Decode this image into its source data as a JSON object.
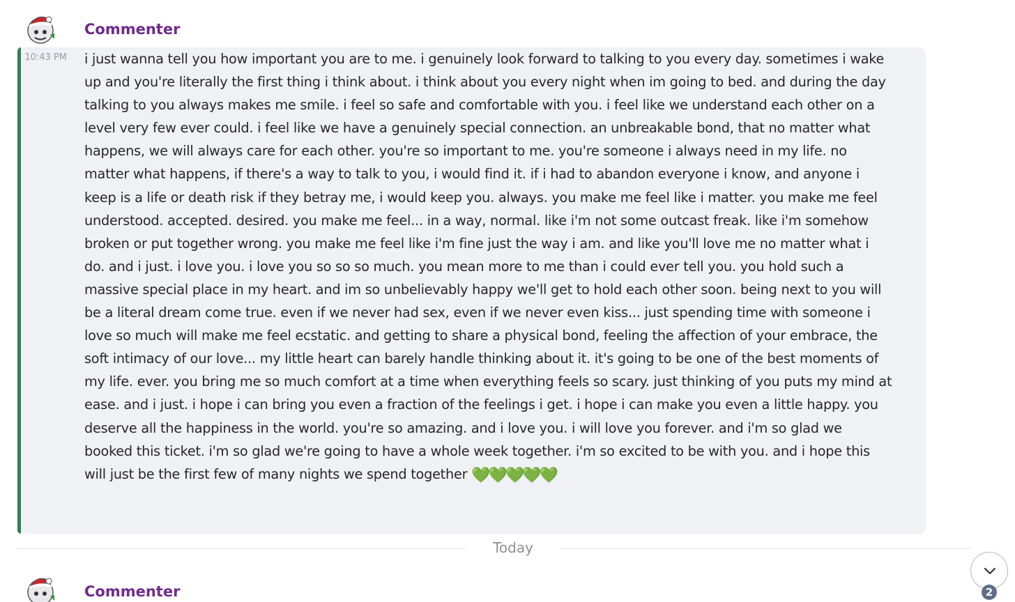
{
  "messages": [
    {
      "author": "Commenter",
      "avatar_icon": "santa-hat-avatar-icon",
      "timestamp": "10:43 PM",
      "text": "i just wanna tell you how important you are to me. i genuinely look forward to talking to you every day. sometimes i wake up and you're literally the first thing i think about. i think about you every night when im going to bed. and during the day talking to you always makes me smile. i feel so safe and comfortable with you. i feel like we understand each other on a level very few ever could. i feel like we have a genuinely special connection. an unbreakable bond, that no matter what happens, we will always care for each other. you're so important to me. you're someone i always need in my life. no matter what happens, if there's a way to talk to you, i would find it. if i had to abandon everyone i know, and anyone i keep is a life or death risk if they betray me, i would keep you. always. you make me feel like i matter. you make me feel understood. accepted. desired. you make me feel... in a way, normal. like i'm not some outcast freak. like i'm somehow broken or put together wrong. you make me feel like i'm fine just the way i am. and like you'll love me no matter what i do. and i just. i love you. i love you so  so so much. you mean more to me than i could ever tell you. you hold such a massive special place in my heart. and im so unbelievably happy we'll get to hold each other soon. being next to you will be a literal dream come true. even if we never had sex, even if we never even kiss... just spending time with someone i love so much will make me feel ecstatic. and getting to share a physical bond, feeling the affection of your embrace, the soft intimacy of our love... my little heart can barely handle thinking about it. it's going to be one of the best moments of my life. ever. you bring me so much comfort at a time when everything feels so scary. just thinking of you puts my mind at ease. and i just. i hope i can bring you even a fraction of the feelings i get. i hope i can make you even a little happy. you deserve all the happiness in the world. you're so amazing. and i love you. i will love you forever. and i'm so glad we booked this ticket. i'm so glad we're going to have a whole week together. i'm so excited to be with you. and i hope this will just be the first few of many nights we spend together",
      "emoji": "💚💚💚💚💚",
      "accent_color": "#2f8052"
    },
    {
      "author": "Commenter",
      "avatar_icon": "santa-hat-avatar-icon"
    }
  ],
  "divider": {
    "label": "Today"
  },
  "scroll_button": {
    "icon": "chevron-down-icon",
    "unread_count": "2"
  },
  "colors": {
    "author": "#6f2b8a",
    "message_background": "#f0f1f5",
    "accent_bar": "#2f8052",
    "badge": "#5d6f86"
  }
}
